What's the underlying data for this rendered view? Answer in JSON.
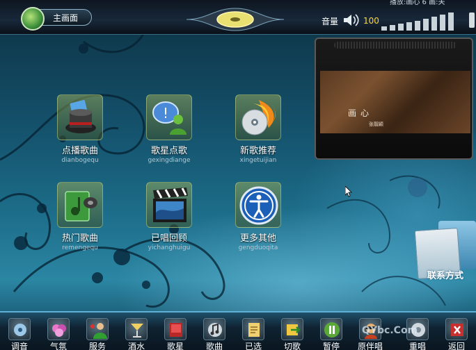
{
  "header": {
    "home_label": "主画面",
    "status_text": "播放:画心 6 画:关",
    "volume_label": "音量",
    "volume_value": "100"
  },
  "menu": [
    {
      "title": "点播歌曲",
      "pinyin": "dianbogequ",
      "icon": "hat-card-icon"
    },
    {
      "title": "歌星点歌",
      "pinyin": "gexingdiange",
      "icon": "singer-chat-icon"
    },
    {
      "title": "新歌推荐",
      "pinyin": "xingetuijian",
      "icon": "flaming-disc-icon"
    },
    {
      "title": "热门歌曲",
      "pinyin": "remengequ",
      "icon": "music-book-icon"
    },
    {
      "title": "已唱回顾",
      "pinyin": "yichanghuigu",
      "icon": "clapperboard-icon"
    },
    {
      "title": "更多其他",
      "pinyin": "gengduoqita",
      "icon": "accessibility-icon"
    }
  ],
  "video": {
    "title": "画心",
    "artist": "张靓颖"
  },
  "contact": {
    "label": "联系方式"
  },
  "toolbar": [
    {
      "label": "调音",
      "icon": "tuning-icon"
    },
    {
      "label": "气氛",
      "icon": "atmosphere-icon"
    },
    {
      "label": "服务",
      "icon": "service-icon"
    },
    {
      "label": "酒水",
      "icon": "drinks-icon"
    },
    {
      "label": "歌星",
      "icon": "singer-icon"
    },
    {
      "label": "歌曲",
      "icon": "song-icon"
    },
    {
      "label": "已选",
      "icon": "selected-icon"
    },
    {
      "label": "切歌",
      "icon": "next-song-icon"
    },
    {
      "label": "暂停",
      "icon": "pause-icon"
    },
    {
      "label": "原伴唱",
      "icon": "vocal-toggle-icon"
    },
    {
      "label": "重唱",
      "icon": "replay-icon"
    },
    {
      "label": "返回",
      "icon": "back-icon"
    }
  ],
  "watermark": "QYbc.Com"
}
